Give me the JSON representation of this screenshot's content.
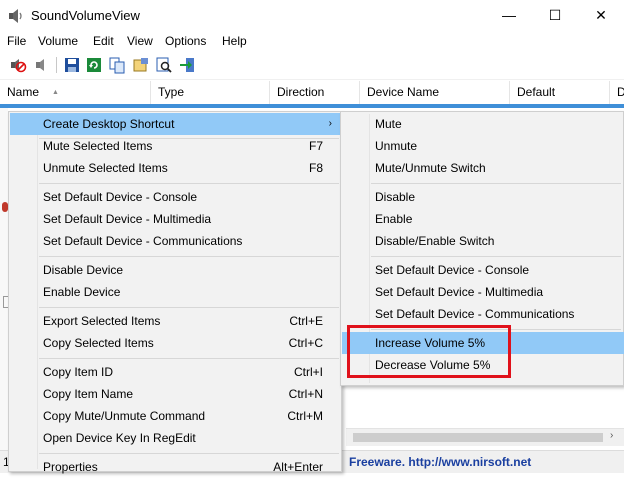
{
  "window": {
    "title": "SoundVolumeView",
    "minimize_glyph": "—",
    "maximize_glyph": "☐",
    "close_glyph": "✕"
  },
  "menubar": [
    "File",
    "Volume",
    "Edit",
    "View",
    "Options",
    "Help"
  ],
  "toolbar": {
    "icons": [
      "mute-icon",
      "speaker-icon",
      "save-icon",
      "refresh-icon",
      "copy-icon",
      "properties-icon",
      "find-icon",
      "exit-icon"
    ]
  },
  "columns": [
    {
      "label": "Name",
      "sort_glyph": "▲"
    },
    {
      "label": "Type"
    },
    {
      "label": "Direction"
    },
    {
      "label": "Device Name"
    },
    {
      "label": "Default"
    },
    {
      "label": "D"
    }
  ],
  "context_menu": {
    "items": [
      {
        "label": "Create Desktop Shortcut",
        "shortcut": "",
        "submenu": true,
        "highlighted": true
      },
      {
        "label": "Mute Selected Items",
        "shortcut": "F7"
      },
      {
        "label": "Unmute Selected Items",
        "shortcut": "F8"
      },
      {
        "label": "Set Default Device - Console",
        "shortcut": ""
      },
      {
        "label": "Set Default Device - Multimedia",
        "shortcut": ""
      },
      {
        "label": "Set Default Device - Communications",
        "shortcut": ""
      },
      {
        "label": "Disable Device",
        "shortcut": ""
      },
      {
        "label": "Enable Device",
        "shortcut": ""
      },
      {
        "label": "Export Selected Items",
        "shortcut": "Ctrl+E"
      },
      {
        "label": "Copy Selected Items",
        "shortcut": "Ctrl+C"
      },
      {
        "label": "Copy Item ID",
        "shortcut": "Ctrl+I"
      },
      {
        "label": "Copy Item Name",
        "shortcut": "Ctrl+N"
      },
      {
        "label": "Copy Mute/Unmute Command",
        "shortcut": "Ctrl+M"
      },
      {
        "label": "Open Device Key In RegEdit",
        "shortcut": ""
      },
      {
        "label": "Properties",
        "shortcut": "Alt+Enter"
      }
    ],
    "submenu_arrow": "›"
  },
  "submenu": {
    "items": [
      {
        "label": "Mute"
      },
      {
        "label": "Unmute"
      },
      {
        "label": "Mute/Unmute Switch"
      },
      {
        "label": "Disable"
      },
      {
        "label": "Enable"
      },
      {
        "label": "Disable/Enable Switch"
      },
      {
        "label": "Set Default Device - Console"
      },
      {
        "label": "Set Default Device - Multimedia"
      },
      {
        "label": "Set Default Device - Communications"
      },
      {
        "label": "Increase Volume 5%",
        "highlighted": true
      },
      {
        "label": "Decrease Volume 5%"
      }
    ]
  },
  "statusbar": {
    "left_text": "1",
    "freeware_text": "Freeware.  http://www.nirsoft.net"
  },
  "scrollbar": {
    "right_arrow": "›"
  },
  "colors": {
    "highlight": "#91c9f7",
    "annotation_box": "#e0111b",
    "selection_strip": "#3f8fd8",
    "link": "#1a3fa0"
  }
}
